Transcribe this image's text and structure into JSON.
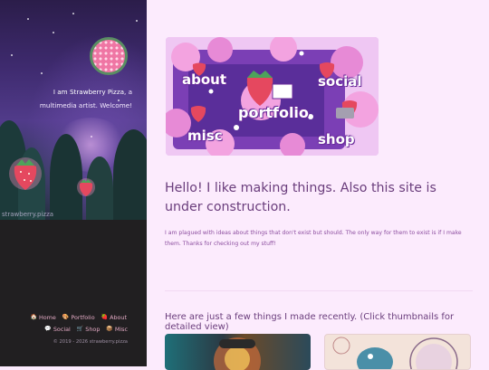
{
  "sidebar": {
    "tagline_name": "I am Strawberry Pizza",
    "tagline_rest": ", a multimedia artist. Welcome!",
    "watermark": "strawberry.pizza",
    "nav": [
      {
        "label": "Home",
        "icon": "home-icon"
      },
      {
        "label": "Portfolio",
        "icon": "palette-icon"
      },
      {
        "label": "About",
        "icon": "strawberry-icon"
      },
      {
        "label": "Social",
        "icon": "chat-icon"
      },
      {
        "label": "Shop",
        "icon": "cart-icon"
      },
      {
        "label": "Misc",
        "icon": "box-icon"
      }
    ],
    "copyright": "© 2019 - 2026 strawberry.pizza"
  },
  "hero": {
    "about": "about",
    "social": "social",
    "portfolio": "portfolio",
    "misc": "misc",
    "shop": "shop"
  },
  "main": {
    "heading": "Hello! I like making things. Also this site is under construction.",
    "paragraph": "I am plagued with ideas about things that don't exist but should. The only way for them to exist is if I make them. Thanks for checking out my stuff!",
    "recent_heading": "Here are just a few things I made recently. (Click thumbnails for detailed view)"
  },
  "colors": {
    "background": "#fcebfd",
    "sidebar": "#211f21",
    "heading": "#6a3d7c",
    "link": "#e2a9c3"
  }
}
